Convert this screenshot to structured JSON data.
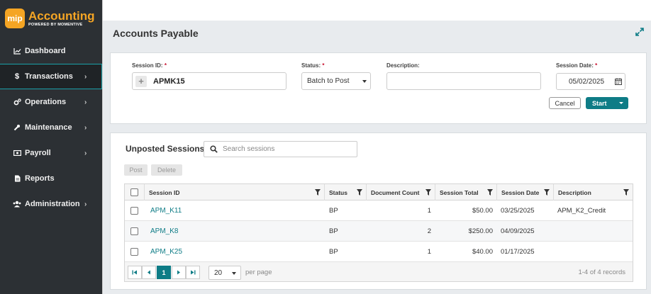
{
  "app": {
    "logo_badge": "mip",
    "logo_title": "Accounting",
    "logo_subtitle": "POWERED BY MOMENTIVE",
    "brand_color": "#f5a524",
    "accent_color": "#0e7c86"
  },
  "sidebar": {
    "items": [
      {
        "label": "Dashboard",
        "icon": "chart-line-icon",
        "chevron": false,
        "active": false
      },
      {
        "label": "Transactions",
        "icon": "dollar-icon",
        "chevron": true,
        "active": true
      },
      {
        "label": "Operations",
        "icon": "gears-icon",
        "chevron": true,
        "active": false
      },
      {
        "label": "Maintenance",
        "icon": "wrench-icon",
        "chevron": true,
        "active": false
      },
      {
        "label": "Payroll",
        "icon": "money-bill-icon",
        "chevron": true,
        "active": false
      },
      {
        "label": "Reports",
        "icon": "file-icon",
        "chevron": false,
        "active": false
      },
      {
        "label": "Administration",
        "icon": "users-icon",
        "chevron": true,
        "active": false
      }
    ]
  },
  "page": {
    "title": "Accounts Payable"
  },
  "form": {
    "session_id_label": "Session ID:",
    "session_id_value": "APMK15",
    "status_label": "Status:",
    "status_value": "Batch to Post",
    "description_label": "Description:",
    "description_value": "",
    "session_date_label": "Session Date:",
    "session_date_value": "05/02/2025",
    "required_mark": "*",
    "cancel_label": "Cancel",
    "start_label": "Start"
  },
  "sessions": {
    "title": "Unposted Sessions",
    "search_placeholder": "Search sessions",
    "post_label": "Post",
    "delete_label": "Delete",
    "columns": [
      "Session ID",
      "Status",
      "Document Count",
      "Session Total",
      "Session Date",
      "Description"
    ],
    "rows": [
      {
        "session_id": "APM_K11",
        "status": "BP",
        "doc_count": "1",
        "total": "$50.00",
        "date": "03/25/2025",
        "description": "APM_K2_Credit"
      },
      {
        "session_id": "APM_K8",
        "status": "BP",
        "doc_count": "2",
        "total": "$250.00",
        "date": "04/09/2025",
        "description": ""
      },
      {
        "session_id": "APM_K25",
        "status": "BP",
        "doc_count": "1",
        "total": "$40.00",
        "date": "01/17/2025",
        "description": ""
      }
    ],
    "pager": {
      "current_page": "1",
      "page_size": "20",
      "per_page_label": "per page",
      "records_text": "1-4 of 4 records"
    }
  }
}
